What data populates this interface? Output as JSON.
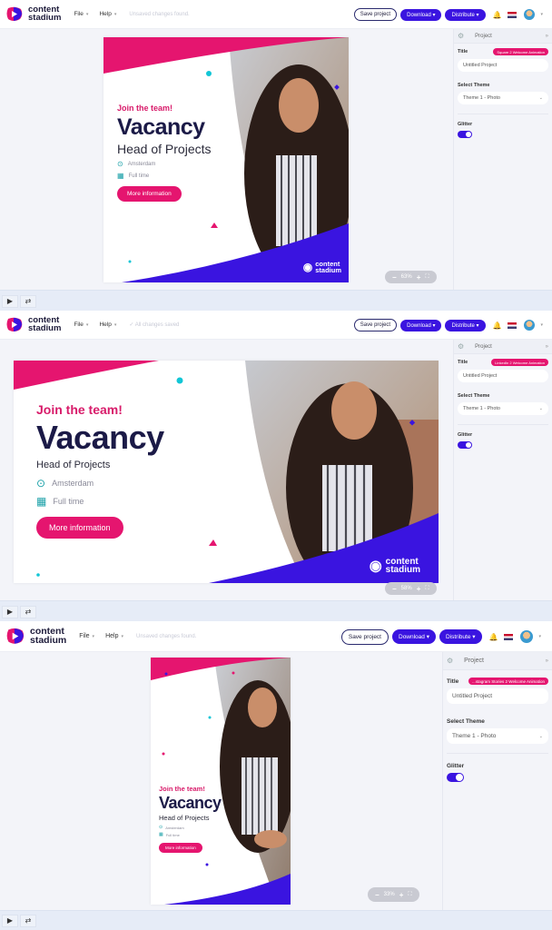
{
  "app": {
    "logo_line1": "content",
    "logo_line2": "stadium",
    "menu": [
      {
        "label": "File"
      },
      {
        "label": "Help"
      }
    ],
    "buttons": {
      "save": "Save project",
      "download": "Download ▾",
      "distribute": "Distribute ▾"
    }
  },
  "frames": [
    {
      "status": "Unsaved changes found.",
      "panel": {
        "header": "Project",
        "title_label": "Title",
        "tag": "Square 2 Welcome Animation",
        "title_value": "Untitled Project",
        "theme_label": "Select Theme",
        "theme_value": "Theme 1 - Photo",
        "glitter_label": "Glitter",
        "glitter_on": true
      },
      "zoom": "63%",
      "format": "square"
    },
    {
      "status": "✓ All changes saved",
      "panel": {
        "header": "Project",
        "title_label": "Title",
        "tag": "LinkedIn 2 Welcome Animation",
        "title_value": "Untitled Project",
        "theme_label": "Select Theme",
        "theme_value": "Theme 1 - Photo",
        "glitter_label": "Glitter",
        "glitter_on": true
      },
      "zoom": "58%",
      "format": "landscape"
    },
    {
      "status": "Unsaved changes found.",
      "panel": {
        "header": "Project",
        "title_label": "Title",
        "tag": "...stagram Stories 2 Welcome Animation",
        "title_value": "Untitled Project",
        "theme_label": "Select Theme",
        "theme_value": "Theme 1 - Photo",
        "glitter_label": "Glitter",
        "glitter_on": true
      },
      "zoom": "33%",
      "format": "story"
    }
  ],
  "ad": {
    "join": "Join the team!",
    "vacancy": "Vacancy",
    "role": "Head of Projects",
    "location": "Amsterdam",
    "type": "Full time",
    "cta": "More information",
    "brand_line1": "content",
    "brand_line2": "stadium"
  },
  "colors": {
    "brand_purple": "#3a14e0",
    "brand_pink": "#e5156f",
    "navy": "#1b1a47",
    "teal": "#1aa0a8"
  },
  "icons": {
    "play": "▶",
    "loop": "⇄",
    "gear": "⚙",
    "collapse": "»",
    "bell": "🔔",
    "zoom_out": "−",
    "zoom_in": "+",
    "fit": "⛶"
  }
}
